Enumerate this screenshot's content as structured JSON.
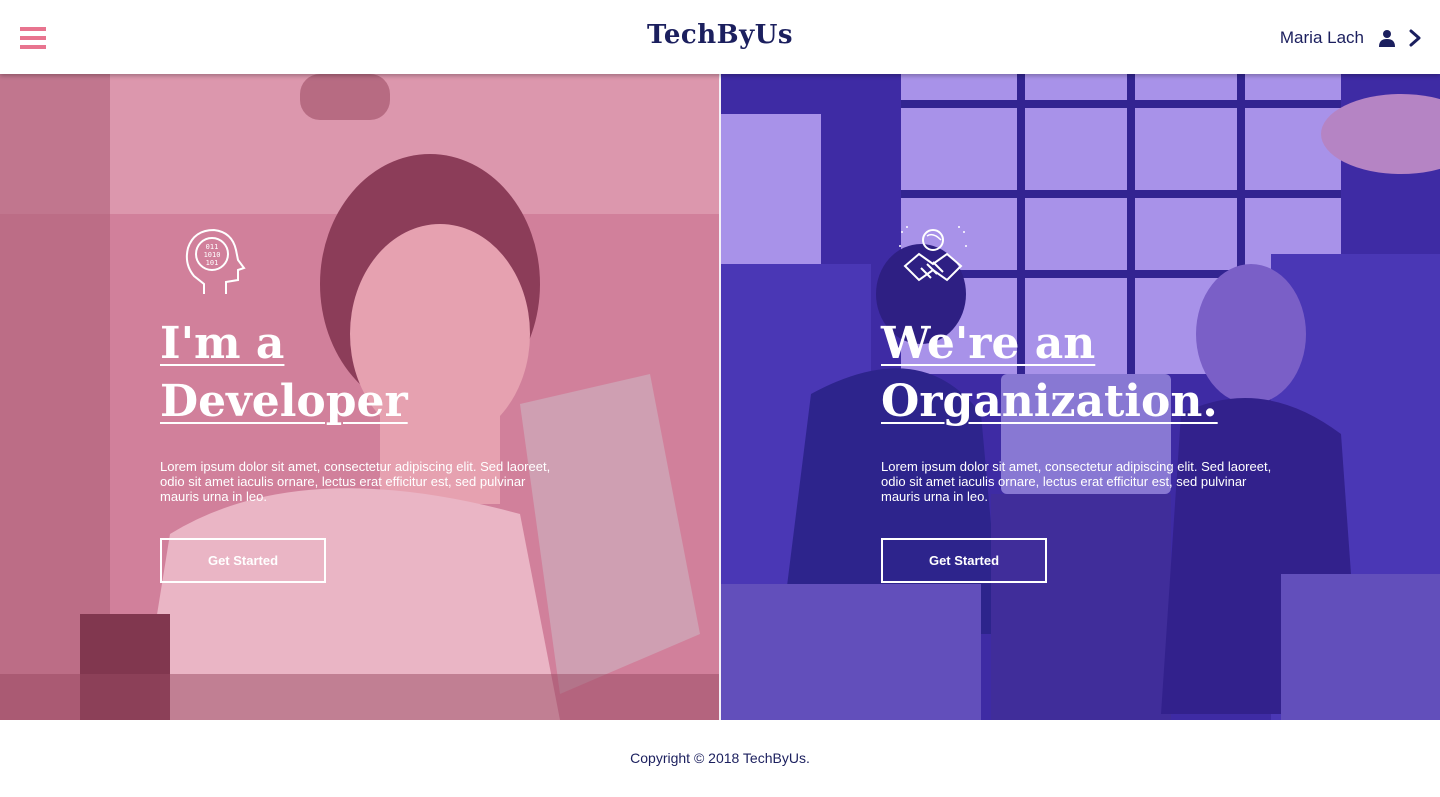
{
  "header": {
    "brand": "TechByUs",
    "user_name": "Maria Lach",
    "menu_icon": "hamburger-menu-icon",
    "user_icon": "user-icon",
    "next_icon": "chevron-right-icon"
  },
  "panels": [
    {
      "icon": "binary-head-icon",
      "title_line1": "I'm a",
      "title_line2": "Developer",
      "description": "Lorem ipsum dolor sit amet, consectetur adipiscing elit. Sed laoreet, odio sit amet iaculis ornare, lectus erat efficitur est, sed pulvinar mauris urna in leo.",
      "button_label": "Get Started",
      "overlay_color": "#e56f9a"
    },
    {
      "icon": "handshake-person-icon",
      "title_line1": "We're an",
      "title_line2": "Organization.",
      "description": "Lorem ipsum dolor sit amet, consectetur adipiscing elit. Sed laoreet, odio sit amet iaculis ornare, lectus erat efficitur est, sed pulvinar mauris urna in leo.",
      "button_label": "Get Started",
      "overlay_color": "#4b2fc4"
    }
  ],
  "footer": {
    "copyright": "Copyright © 2018 TechByUs."
  },
  "colors": {
    "brand_navy": "#1b1f5e",
    "accent_pink": "#e8748f"
  }
}
